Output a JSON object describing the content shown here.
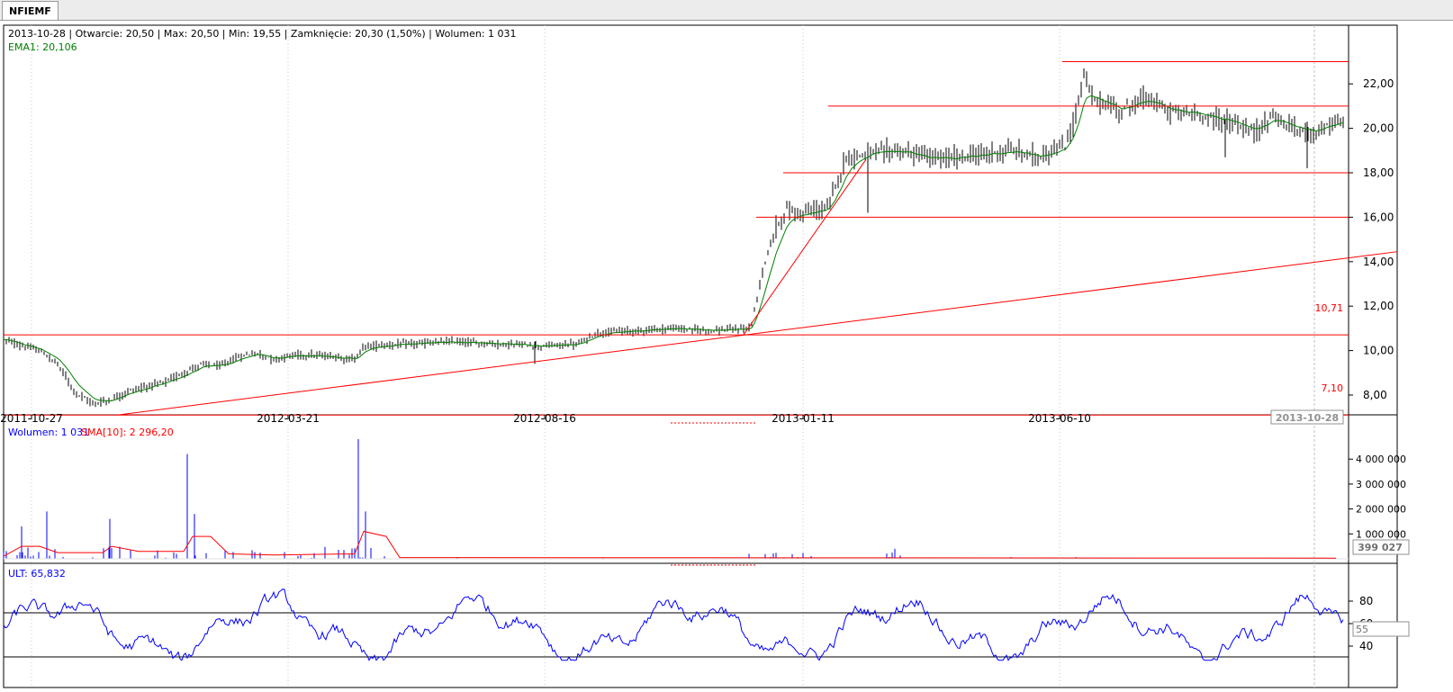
{
  "window": {
    "tab_label": "NFIEMF"
  },
  "price_panel": {
    "info_line": "2013-10-28 | Otwarcie: 20,50 | Max: 20,50 | Min: 19,55 | Zamknięcie: 20,30 (1,50%) | Wolumen: 1 031",
    "ema_label": "EMA1: 20,106",
    "level_labels": [
      "10,71",
      "7,10"
    ]
  },
  "volume_panel": {
    "volume_label": "Wolumen: 1 031",
    "sma_label": "SMA[10]: 2 296,20",
    "current_value": "399 027"
  },
  "ult_panel": {
    "ult_label": "ULT: 65,832",
    "current_value": "55"
  },
  "colors": {
    "price_bars": "#000000",
    "ema": "#008000",
    "lines": "#ff0000",
    "volume": "#0000ff",
    "sma": "#ff0000",
    "ult": "#0000ff"
  },
  "chart_data": [
    {
      "type": "line",
      "title": "NFIEMF",
      "x_dates": [
        "2011-10-27",
        "2012-03-21",
        "2012-08-16",
        "2013-01-11",
        "2013-06-10",
        "2013-10-28"
      ],
      "ylim": [
        7,
        23
      ],
      "y_ticks": [
        "8,00",
        "10,00",
        "12,00",
        "14,00",
        "16,00",
        "18,00",
        "20,00",
        "22,00"
      ],
      "price_path_approx": [
        [
          0,
          10.5
        ],
        [
          20,
          10.2
        ],
        [
          40,
          10.0
        ],
        [
          60,
          9.4
        ],
        [
          80,
          8.1
        ],
        [
          100,
          7.6
        ],
        [
          120,
          7.8
        ],
        [
          140,
          8.2
        ],
        [
          160,
          8.4
        ],
        [
          180,
          8.6
        ],
        [
          200,
          9.0
        ],
        [
          220,
          9.4
        ],
        [
          240,
          9.3
        ],
        [
          260,
          9.7
        ],
        [
          280,
          9.9
        ],
        [
          300,
          9.6
        ],
        [
          320,
          9.8
        ],
        [
          340,
          9.8
        ],
        [
          370,
          9.7
        ],
        [
          390,
          9.6
        ],
        [
          400,
          10.2
        ],
        [
          450,
          10.3
        ],
        [
          500,
          10.4
        ],
        [
          550,
          10.3
        ],
        [
          600,
          10.2
        ],
        [
          638,
          10.3
        ],
        [
          660,
          10.8
        ],
        [
          700,
          10.9
        ],
        [
          740,
          11.0
        ],
        [
          790,
          10.9
        ],
        [
          830,
          11.0
        ],
        [
          840,
          13.0
        ],
        [
          850,
          14.6
        ],
        [
          860,
          15.7
        ],
        [
          870,
          16.3
        ],
        [
          890,
          16.2
        ],
        [
          915,
          16.4
        ],
        [
          925,
          17.5
        ],
        [
          935,
          18.6
        ],
        [
          960,
          18.9
        ],
        [
          990,
          19.0
        ],
        [
          1040,
          18.6
        ],
        [
          1080,
          18.8
        ],
        [
          1120,
          19.0
        ],
        [
          1150,
          18.7
        ],
        [
          1180,
          19.2
        ],
        [
          1190,
          20.5
        ],
        [
          1200,
          22.5
        ],
        [
          1210,
          21.3
        ],
        [
          1240,
          20.8
        ],
        [
          1270,
          21.4
        ],
        [
          1290,
          20.8
        ],
        [
          1330,
          20.6
        ],
        [
          1360,
          20.3
        ],
        [
          1390,
          19.8
        ],
        [
          1410,
          20.6
        ],
        [
          1430,
          20.0
        ],
        [
          1450,
          19.8
        ],
        [
          1470,
          20.1
        ],
        [
          1488,
          20.3
        ]
      ],
      "series": [
        {
          "name": "EMA1",
          "value": 20.106
        },
        {
          "name": "Trend lines",
          "levels": [
            10.71,
            7.1,
            16.0,
            18.0,
            21.0,
            23.0
          ]
        }
      ]
    },
    {
      "type": "bar",
      "ylim": [
        0,
        4700000
      ],
      "y_ticks": [
        "1 000 000",
        "2 000 000",
        "3 000 000",
        "4 000 000"
      ],
      "series": [
        {
          "name": "Wolumen",
          "spikes": [
            [
              20,
              1300000
            ],
            [
              48,
              1900000
            ],
            [
              118,
              1600000
            ],
            [
              204,
              4200000
            ],
            [
              212,
              1800000
            ],
            [
              394,
              4800000
            ],
            [
              402,
              1900000
            ],
            [
              990,
              400000
            ]
          ]
        },
        {
          "name": "SMA[10]",
          "path_approx": [
            [
              0,
              100000
            ],
            [
              20,
              500000
            ],
            [
              40,
              500000
            ],
            [
              60,
              250000
            ],
            [
              110,
              250000
            ],
            [
              120,
              500000
            ],
            [
              150,
              300000
            ],
            [
              200,
              300000
            ],
            [
              210,
              900000
            ],
            [
              230,
              900000
            ],
            [
              250,
              200000
            ],
            [
              300,
              150000
            ],
            [
              390,
              200000
            ],
            [
              400,
              1100000
            ],
            [
              425,
              900000
            ],
            [
              440,
              50000
            ],
            [
              1480,
              30000
            ]
          ]
        }
      ]
    },
    {
      "type": "line",
      "ylim": [
        25,
        100
      ],
      "y_ticks": [
        "40",
        "60",
        "80"
      ],
      "series": [
        {
          "name": "ULT",
          "value": 65.832,
          "reference_levels": [
            70,
            30
          ]
        }
      ]
    }
  ]
}
